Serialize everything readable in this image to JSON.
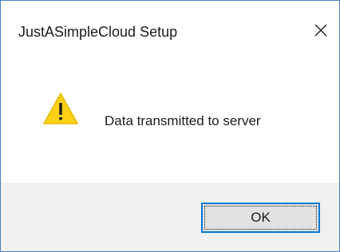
{
  "window": {
    "title": "JustASimpleCloud Setup",
    "close_icon": "close-icon",
    "accent_color": "#0078d7",
    "border_color": "#4a7cc4"
  },
  "message": {
    "icon": "warning-icon",
    "icon_color": "#fcd116",
    "text": "Data transmitted to server"
  },
  "footer": {
    "ok_label": "OK"
  }
}
